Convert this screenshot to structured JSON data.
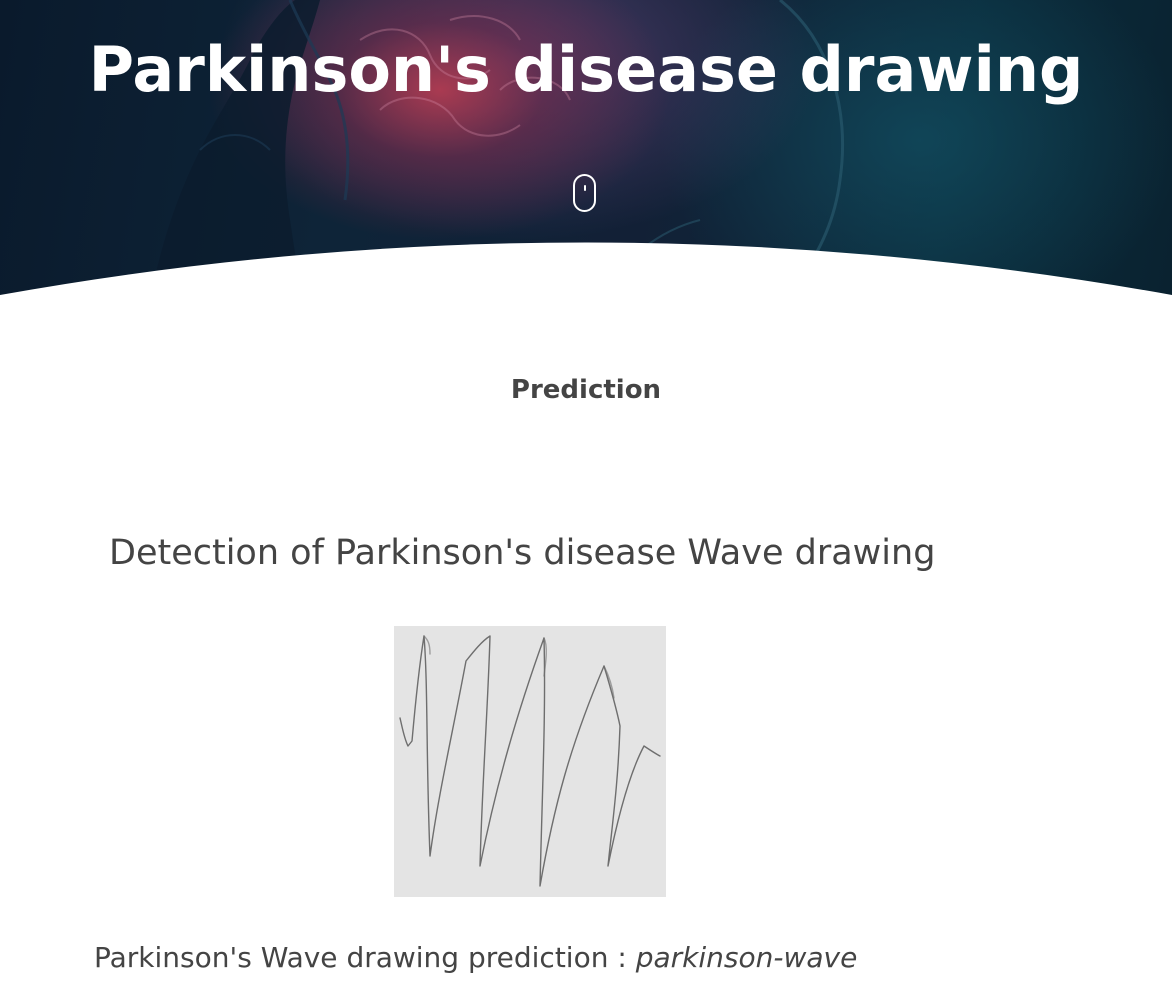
{
  "hero": {
    "title": "Parkinson's disease drawing",
    "scroll_icon": "mouse-scroll-icon"
  },
  "section": {
    "title": "Prediction"
  },
  "detection": {
    "heading": "Detection of Parkinson's disease Wave drawing",
    "image_alt": "Parkinson's wave drawing"
  },
  "result": {
    "label": "Parkinson's Wave drawing prediction : ",
    "value": "parkinson-wave"
  },
  "colors": {
    "text": "#444444",
    "hero_dark": "#0e2438",
    "hero_accent": "#be3c50",
    "background": "#ffffff"
  }
}
